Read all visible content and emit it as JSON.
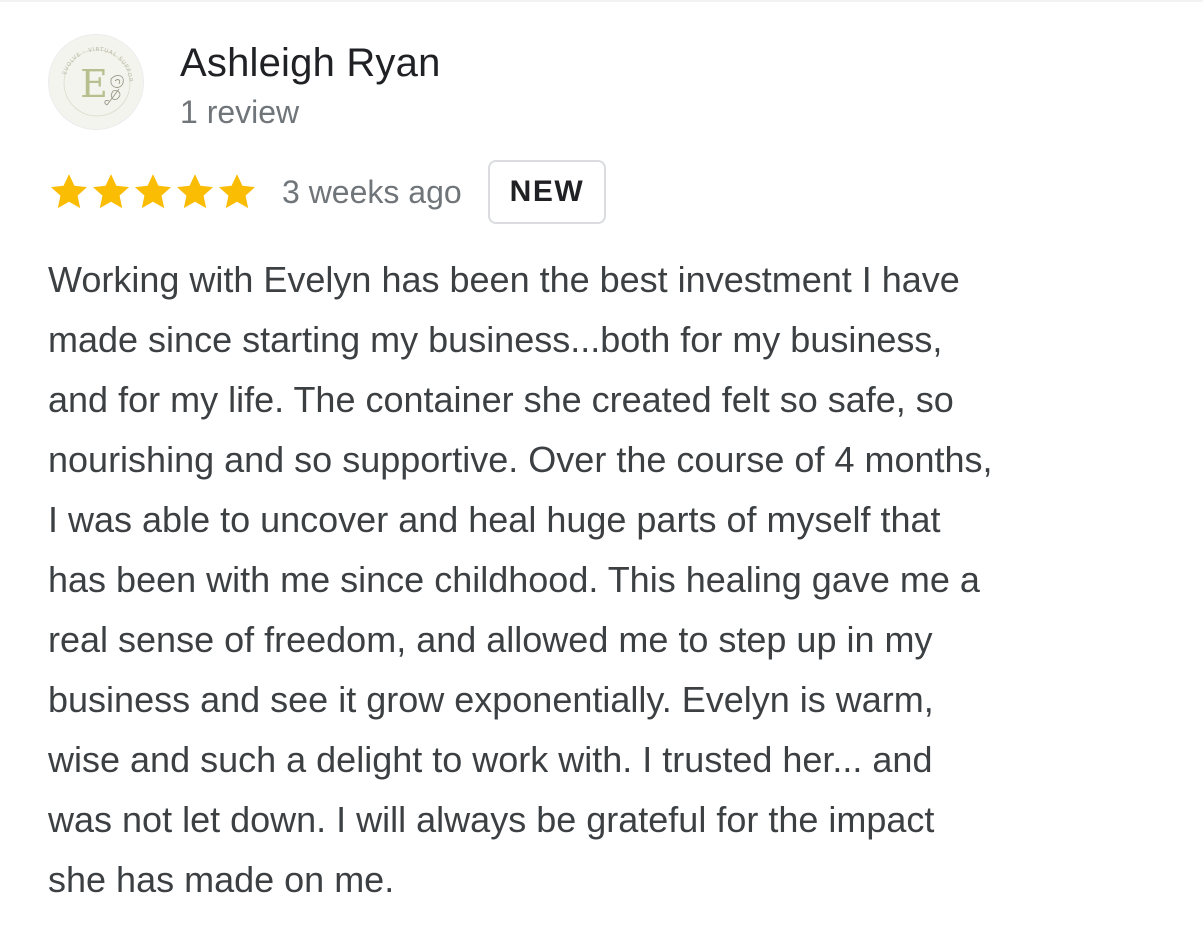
{
  "review": {
    "reviewer": {
      "name": "Ashleigh Ryan",
      "review_count": "1 review",
      "avatar": {
        "icon": "logo-avatar-icon",
        "letter": "E",
        "ring_text": "EVOLVE · VIRTUAL SUPPORT"
      }
    },
    "rating": {
      "stars": 5,
      "max_stars": 5,
      "star_color": "#fbbc04"
    },
    "time": "3 weeks ago",
    "badge": "NEW",
    "text": "Working with Evelyn has been the best investment I have\nmade since starting my business...both for my business,\nand for my life. The container she created felt so safe, so\nnourishing and so supportive. Over the course of 4 months,\nI was able to uncover and heal huge parts of myself that\nhas been with me since childhood. This healing gave me a\nreal sense of freedom, and allowed me to step up in my\nbusiness and see it grow exponentially. Evelyn is warm,\nwise and such a delight to work with. I trusted her... and\nwas not let down. I will always be grateful for the impact\nshe has made on me."
  }
}
